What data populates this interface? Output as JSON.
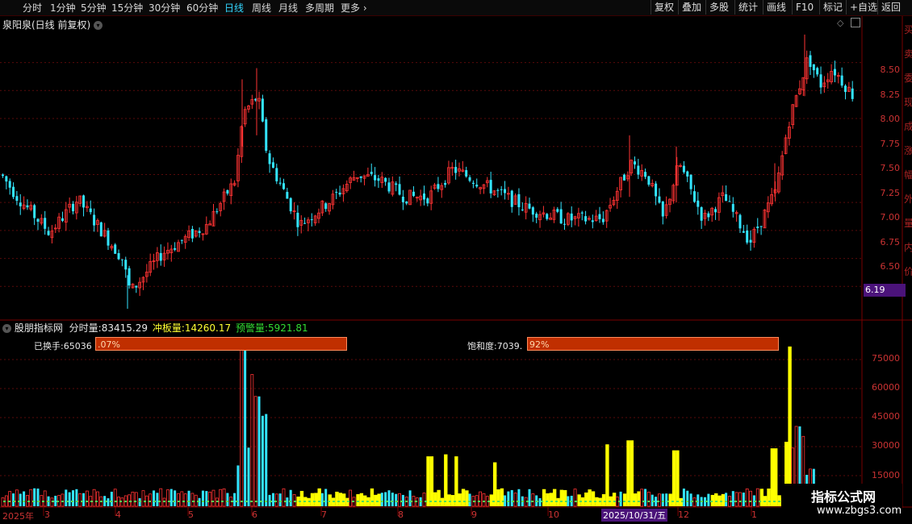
{
  "toolbar": {
    "periods": [
      "分时",
      "1分钟",
      "5分钟",
      "15分钟",
      "30分钟",
      "60分钟",
      "日线",
      "周线",
      "月线",
      "多周期",
      "更多"
    ],
    "active_period": "日线",
    "right_buttons": [
      "复权",
      "叠加",
      "多股",
      "统计",
      "画线",
      "F10",
      "标记",
      "+自选",
      "返回"
    ]
  },
  "stock": {
    "title": "泉阳泉(日线 前复权)",
    "last_price_tag": "6.19"
  },
  "price_axis": [
    "8.50",
    "8.25",
    "8.00",
    "7.75",
    "7.50",
    "7.25",
    "7.00",
    "6.75",
    "6.50"
  ],
  "indicator": {
    "name": "股朋指标网",
    "fields": [
      {
        "label": "分时量:",
        "value": "83415.29",
        "color": "#e8e8e8"
      },
      {
        "label": "冲板量:",
        "value": "14260.17",
        "color": "#ffff33"
      },
      {
        "label": "预警量:",
        "value": "5921.81",
        "color": "#33dd33"
      }
    ],
    "turnover_label": "已换手:65036",
    "turnover_bar_text": ".07%",
    "saturation_label": "饱和度:7039.",
    "saturation_bar_text": "92%"
  },
  "volume_axis": [
    "75000",
    "60000",
    "45000",
    "30000",
    "15000"
  ],
  "months": [
    "2025年",
    "3",
    "4",
    "5",
    "6",
    "7",
    "8",
    "9",
    "10",
    "12",
    "1"
  ],
  "selected_date": "2025/10/31/五",
  "watermark": {
    "title": "指标公式网",
    "url": "www.zbgs3.com"
  },
  "right_strip_chars": [
    "买",
    "卖",
    "委",
    "现",
    "成",
    "涨",
    "幅",
    "外",
    "量",
    "内",
    "价"
  ],
  "colors": {
    "up": "#ff3333",
    "down": "#33e5ff",
    "yellow": "#ffff00",
    "grid": "#5a0a0a"
  },
  "chart_data": {
    "type": "candlestick",
    "price_ylim": [
      6.25,
      8.85
    ],
    "volume_ylim": [
      0,
      88000
    ],
    "series": [
      {
        "name": "分时量",
        "values": []
      }
    ]
  }
}
